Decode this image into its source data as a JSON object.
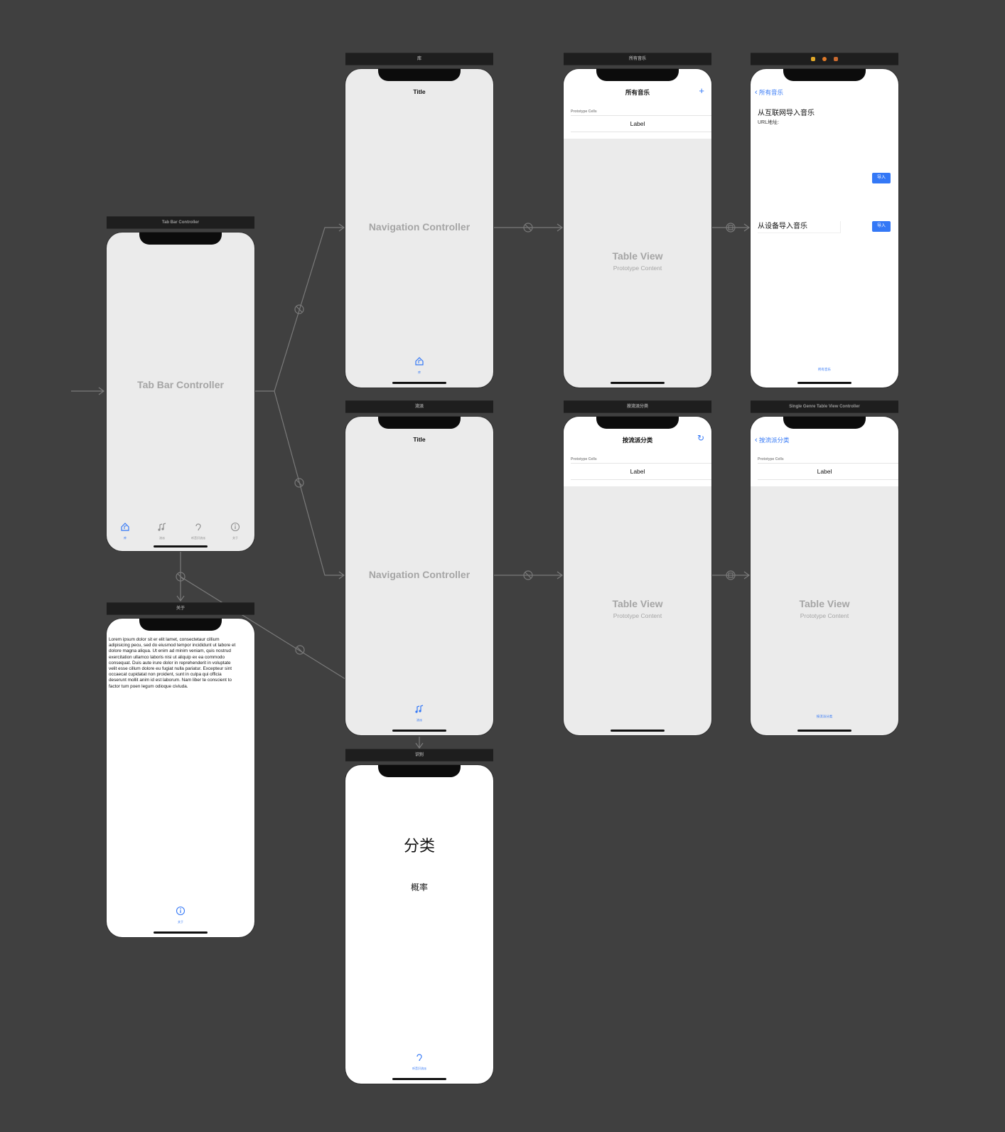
{
  "tab_bar_scene": {
    "bar_title": "Tab Bar Controller",
    "center_label": "Tab Bar Controller",
    "tabs": [
      {
        "label": "库",
        "icon": "house-music-icon",
        "active": true
      },
      {
        "label": "流派",
        "icon": "music-notes-icon",
        "active": false
      },
      {
        "label": "听音识流派",
        "icon": "ear-icon",
        "active": false
      },
      {
        "label": "关于",
        "icon": "info-circle-icon",
        "active": false
      }
    ]
  },
  "library_nav_scene": {
    "bar_title": "库",
    "nav_title": "Title",
    "center_label": "Navigation Controller",
    "tab_label": "库"
  },
  "all_music_scene": {
    "bar_title": "所有音乐",
    "nav_title": "所有音乐",
    "add_icon": "+",
    "prototype_cells": "Prototype Cells",
    "cell_label": "Label",
    "table_view": "Table View",
    "prototype_content": "Prototype Content"
  },
  "import_scene": {
    "back_label": "所有音乐",
    "internet_title": "从互联网导入音乐",
    "url_label": "URL地址:",
    "import_button_1": "导入",
    "device_title": "从设备导入音乐",
    "import_button_2": "导入",
    "tab_label": "所有音乐"
  },
  "genre_nav_scene": {
    "bar_title": "流派",
    "nav_title": "Title",
    "center_label": "Navigation Controller",
    "tab_label": "流派"
  },
  "genre_table_scene": {
    "bar_title": "按流派分类",
    "nav_title": "按流派分类",
    "refresh_icon": "↻",
    "prototype_cells": "Prototype Cells",
    "cell_label": "Label",
    "table_view": "Table View",
    "prototype_content": "Prototype Content"
  },
  "single_genre_scene": {
    "bar_title": "Single Genre Table View Controller",
    "back_label": "按流派分类",
    "prototype_cells": "Prototype Cells",
    "cell_label": "Label",
    "table_view": "Table View",
    "prototype_content": "Prototype Content",
    "tab_label": "按流派分类"
  },
  "about_scene": {
    "bar_title": "关于",
    "body_text": "Lorem ipsum dolor sit er elit lamet, consectetaur cillium adipisicing pecu, sed do eiusmod tempor incididunt ut labore et dolore magna aliqua. Ut enim ad minim veniam, quis nostrud exercitation ullamco laboris nisi ut aliquip ex ea commodo consequat. Duis aute irure dolor in reprehenderit in voluptate velit esse cillum dolore eu fugiat nulla pariatur. Excepteur sint occaecat cupidatat non proident, sunt in culpa qui officia deserunt mollit anim id est laborum. Nam liber te conscient to factor tum poen legum odioque civiuda.",
    "tab_label": "关于"
  },
  "recognize_scene": {
    "bar_title": "识别",
    "class_label": "分类",
    "probability_label": "概率",
    "tab_label": "听音识流派"
  },
  "colors": {
    "canvas": "#404040",
    "accent": "#3478f6",
    "placeholder_text": "#a5a5a5",
    "scene_bar": "#1e1e1e"
  }
}
